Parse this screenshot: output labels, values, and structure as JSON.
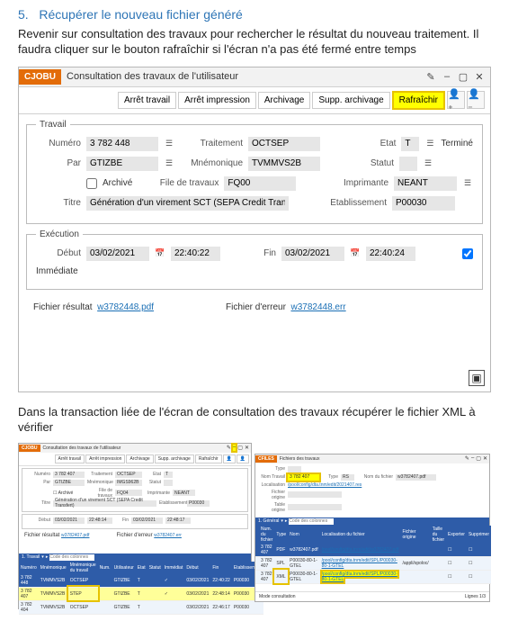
{
  "step": {
    "number": "5.",
    "title": "Récupérer le nouveau fichier généré"
  },
  "instr": "Revenir sur consultation des travaux pour rechercher le résultat du nouveau traitement. Il faudra cliquer sur le bouton rafraîchir si l'écran n'a pas été fermé entre temps",
  "note2": "Dans la transaction liée de l'écran de consultation des travaux récupérer le fichier XML à vérifier",
  "mainwin": {
    "badge": "CJOBU",
    "title": "Consultation des travaux de l'utilisateur",
    "toolbar": {
      "arret_travail": "Arrêt travail",
      "arret_impression": "Arrêt impression",
      "archivage": "Archivage",
      "supp_archivage": "Supp. archivage",
      "rafraichir": "Rafraîchir"
    },
    "travail": {
      "legend": "Travail",
      "numero_lbl": "Numéro",
      "numero": "3 782 448",
      "traitement_lbl": "Traitement",
      "traitement": "OCTSEP",
      "etat_lbl": "Etat",
      "etat": "T",
      "etat_txt": "Terminé",
      "par_lbl": "Par",
      "par": "GTIZBE",
      "mnemo_lbl": "Mnémonique",
      "mnemo": "TVMMVS2B",
      "statut_lbl": "Statut",
      "archive_lbl": "Archivé",
      "file_lbl": "File de travaux",
      "file": "FQ00",
      "imprim_lbl": "Imprimante",
      "imprim": "NEANT",
      "titre_lbl": "Titre",
      "titre": "Génération d'un virement SCT (SEPA Credit Transfert)",
      "etab_lbl": "Etablissement",
      "etab": "P00030"
    },
    "exec": {
      "legend": "Exécution",
      "debut_lbl": "Début",
      "debut_date": "03/02/2021",
      "debut_time": "22:40:22",
      "fin_lbl": "Fin",
      "fin_date": "03/02/2021",
      "fin_time": "22:40:24",
      "immediate_lbl": "Immédiate"
    },
    "links": {
      "resultat_lbl": "Fichier résultat",
      "resultat": "w3782448.pdf",
      "erreur_lbl": "Fichier d'erreur",
      "erreur": "w3782448.err"
    }
  },
  "comp": {
    "left": {
      "badge": "CJOBU",
      "title": "Consultation des travaux de l'utilisateur",
      "tb": {
        "t1": "Arrêt travail",
        "t2": "Arrêt impression",
        "t3": "Archivage",
        "t4": "Supp. archivage",
        "t5": "Rafraîchir"
      },
      "travail": {
        "numero": "3 782 407",
        "traitement": "OCTSEP",
        "etat": "T",
        "par": "GTIZBE",
        "mnemo": "IMGS962B",
        "statut": "",
        "file": "FQ04",
        "imprim": "NEANT",
        "titre": "Génération d'un virement SCT (SEPA Credit Transfert)",
        "etab": "P00030"
      },
      "exec": {
        "debut_date": "03/02/2021",
        "debut_time": "22:48:14",
        "fin_date": "03/02/2021",
        "fin_time": "22:48:17"
      },
      "res_lbl": "Fichier résultat",
      "res": "w3782407.pdf",
      "err_lbl": "Fichier d'erreur",
      "err": "w3782407.err",
      "filter": {
        "lbl": "1. Travail",
        "ph": "Code des colonnes"
      },
      "table": {
        "cols": [
          "Numéro",
          "Mnémonique",
          "Mnémonique du travail",
          "Num.",
          "Utilisateur",
          "Etat",
          "Statut",
          "Immédiat",
          "Début",
          "Fin",
          "Etablissement"
        ],
        "rows": [
          {
            "num": "3 782 448",
            "mnemo": "TVMMVS2B",
            "tr": "OCTSEP",
            "u": "GTIZBE",
            "e": "T",
            "im": "✓",
            "d": "03/02/2021",
            "f": "22:40:22",
            "et": "P00030"
          },
          {
            "num": "3 782 407",
            "mnemo": "TVMMVS2B",
            "tr": "STEP",
            "u": "GTIZBE",
            "e": "T",
            "im": "✓",
            "d": "03/02/2021",
            "f": "22:48:14",
            "et": "P00030"
          },
          {
            "num": "3 782 404",
            "mnemo": "TVMMVS2B",
            "tr": "OCTSEP",
            "u": "GTIZBE",
            "e": "T",
            "im": "",
            "d": "03/02/2021",
            "f": "22:46:17",
            "et": "P00030"
          }
        ]
      }
    },
    "right": {
      "badge": "CFILES",
      "title": "Fichiers des travaux",
      "form": {
        "type_lbl": "Type",
        "trav_lbl": "Nom Travail",
        "trav": "3 782 407",
        "tpe_lbl": "Type",
        "tpe": "RS",
        "nom_lbl": "Nom du fichier",
        "nom": "w3782407.pdf",
        "loc_lbl": "Localisation",
        "loc": "/pool/config/dta.tnm/edit/2021407.res",
        "fo_lbl": "Fichier origine",
        "to_lbl": "Table origine"
      },
      "filter": {
        "lbl": "1. Général",
        "ph": "Code des colonnes"
      },
      "table": {
        "cols": [
          "",
          "Num. du fichier",
          "Type",
          "Nom",
          "Localisation du fichier",
          "Fichier origine",
          "Taille du fichier",
          "Exporter",
          "Supprimer"
        ],
        "rows": [
          {
            "n": "3 782 407",
            "t": "PDF",
            "nom": "w3782407.pdf",
            "loc": "/pool/config/dta.tnm/edit/w3782407.pdf",
            "fo": "",
            "sz": "",
            "ex": "☐",
            "sp": "☐"
          },
          {
            "n": "3 782 407",
            "t": "SPL",
            "nom": "P00030-80-1-GTEL",
            "loc": "/pool/config/dta.tnm/edit/SPL/P00030-80-1-GTEL",
            "fo": "/appli/spoloc/",
            "sz": "",
            "ex": "☐",
            "sp": "☐"
          },
          {
            "n": "3 782 407",
            "t": "XML",
            "nom": "P00030-80-1-GTEL",
            "loc": "/pool/config/dta.tnm/edit/SPL/P00030-80-1-GTEL",
            "fo": "",
            "sz": "",
            "ex": "☐",
            "sp": "☐"
          }
        ]
      },
      "footer": {
        "mode": "Mode consultation",
        "pag": "Lignes 1/3"
      }
    }
  }
}
